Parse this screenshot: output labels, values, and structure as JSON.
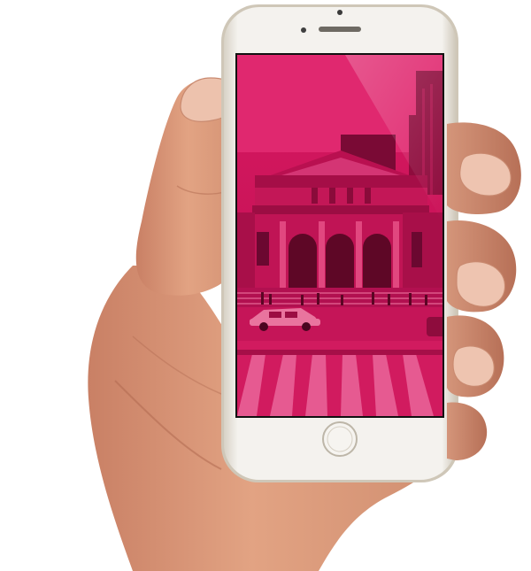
{
  "scene": {
    "subject": "hand-holding-smartphone",
    "device": {
      "body_color": "#ece9e2",
      "bezel_color": "#f7f6f3",
      "screen_tint": "#d4185f"
    },
    "screen_photo": {
      "tint_color": "#cf1458",
      "shadow_color": "#8e0c3d",
      "highlight_color": "#ee6a98"
    },
    "hand": {
      "skin_color": "#e2a383",
      "skin_shadow": "#b86f55",
      "skin_highlight": "#f2c2a5"
    }
  }
}
